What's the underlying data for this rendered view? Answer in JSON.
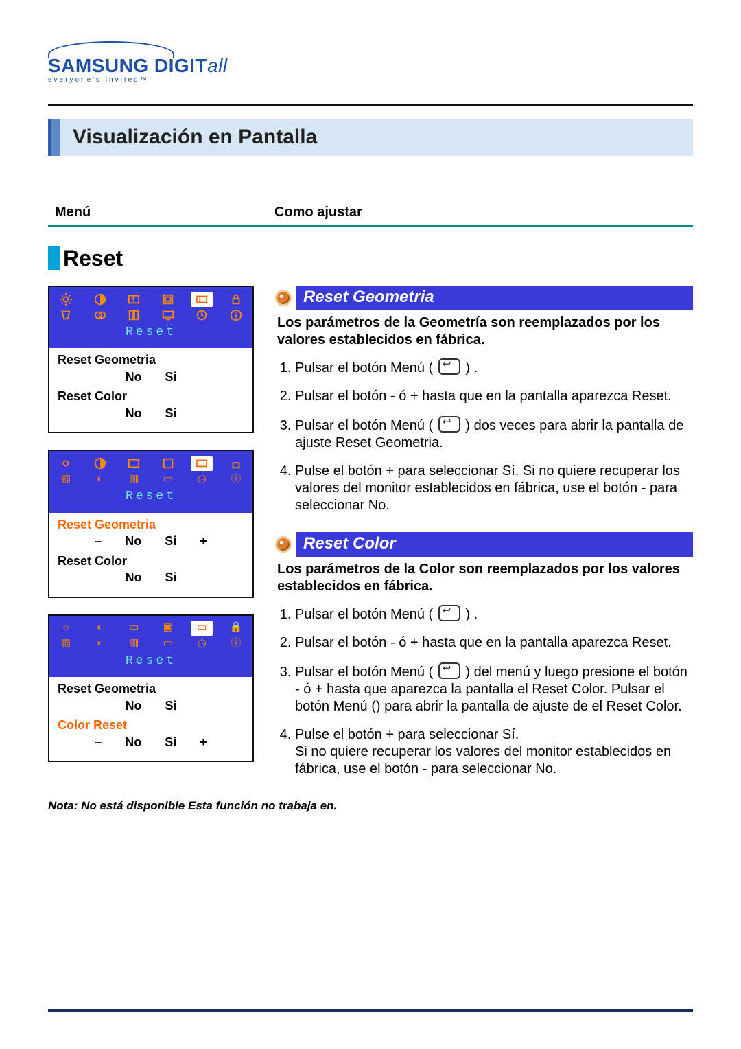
{
  "logo": {
    "brand_main": "SAMSUNG DIGIT",
    "brand_suffix": "all",
    "tagline": "everyone's invited™"
  },
  "page_title": "Visualización en Pantalla",
  "headers": {
    "menu": "Menú",
    "howto": "Como ajustar"
  },
  "section_title": "Reset",
  "osd_common": {
    "reset_label": "Reset",
    "geom_label": "Reset Geometria",
    "color_label": "Reset Color",
    "color_reset_label": "Color Reset",
    "no": "No",
    "si": "Si",
    "minus": "–",
    "plus": "+"
  },
  "items": {
    "geom": {
      "title": "Reset Geometria",
      "lead": "Los parámetros de la Geometría son reemplazados por los valores establecidos en fábrica.",
      "steps": [
        "Pulsar el botón Menú (",
        "Pulsar el botón - ó + hasta que en la pantalla aparezca Reset.",
        "Pulsar el botón Menú (",
        "Pulse el botón + para seleccionar Sí. Si no quiere recuperar los valores del monitor establecidos en fábrica, use el botón - para seleccionar No."
      ],
      "step1_tail": " ) .",
      "step3_tail": " ) dos veces para abrir la pantalla de ajuste Reset Geometria."
    },
    "color": {
      "title": "Reset Color",
      "lead": "Los parámetros de la Color son reemplazados por los valores establecidos en fábrica.",
      "steps": [
        "Pulsar el botón Menú (",
        "Pulsar el botón - ó + hasta que en la pantalla aparezca Reset.",
        "Pulsar el botón Menú (",
        "Pulse el botón + para seleccionar Sí.\nSi no quiere recuperar los valores del monitor establecidos en fábrica, use el botón - para seleccionar No."
      ],
      "step1_tail": " ) .",
      "step3_tail": " ) del menú y luego presione el botón - ó + hasta que aparezca la pantalla el Reset Color. Pulsar el botón Menú () para abrir la pantalla de ajuste de el Reset Color."
    }
  },
  "note": "Nota: No está disponible  Esta función no trabaja en."
}
